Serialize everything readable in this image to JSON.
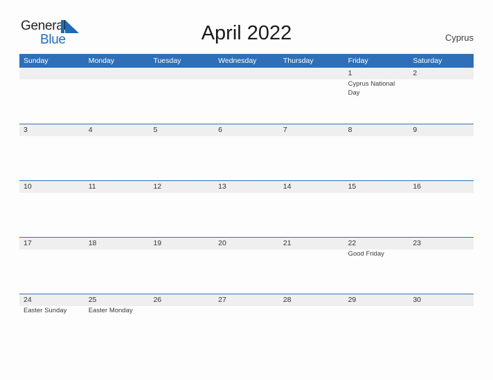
{
  "logo": {
    "word1": "General",
    "word2": "Blue",
    "triangle_icon": "blue-triangle-icon",
    "color_dark": "#231f20",
    "color_blue": "#1f6cb4"
  },
  "header": {
    "title": "April 2022",
    "country": "Cyprus"
  },
  "theme": {
    "header_blue": "#2e6fb7",
    "date_band_gray": "#efefef",
    "page_background": "#fdfdfd",
    "text_color": "#333333"
  },
  "calendar": {
    "day_headers": [
      "Sunday",
      "Monday",
      "Tuesday",
      "Wednesday",
      "Thursday",
      "Friday",
      "Saturday"
    ],
    "weeks": [
      [
        {
          "date": "",
          "events": []
        },
        {
          "date": "",
          "events": []
        },
        {
          "date": "",
          "events": []
        },
        {
          "date": "",
          "events": []
        },
        {
          "date": "",
          "events": []
        },
        {
          "date": "1",
          "events": [
            "Cyprus National Day"
          ]
        },
        {
          "date": "2",
          "events": []
        }
      ],
      [
        {
          "date": "3",
          "events": []
        },
        {
          "date": "4",
          "events": []
        },
        {
          "date": "5",
          "events": []
        },
        {
          "date": "6",
          "events": []
        },
        {
          "date": "7",
          "events": []
        },
        {
          "date": "8",
          "events": []
        },
        {
          "date": "9",
          "events": []
        }
      ],
      [
        {
          "date": "10",
          "events": []
        },
        {
          "date": "11",
          "events": []
        },
        {
          "date": "12",
          "events": []
        },
        {
          "date": "13",
          "events": []
        },
        {
          "date": "14",
          "events": []
        },
        {
          "date": "15",
          "events": []
        },
        {
          "date": "16",
          "events": []
        }
      ],
      [
        {
          "date": "17",
          "events": []
        },
        {
          "date": "18",
          "events": []
        },
        {
          "date": "19",
          "events": []
        },
        {
          "date": "20",
          "events": []
        },
        {
          "date": "21",
          "events": []
        },
        {
          "date": "22",
          "events": [
            "Good Friday"
          ]
        },
        {
          "date": "23",
          "events": []
        }
      ],
      [
        {
          "date": "24",
          "events": [
            "Easter Sunday"
          ]
        },
        {
          "date": "25",
          "events": [
            "Easter Monday"
          ]
        },
        {
          "date": "26",
          "events": []
        },
        {
          "date": "27",
          "events": []
        },
        {
          "date": "28",
          "events": []
        },
        {
          "date": "29",
          "events": []
        },
        {
          "date": "30",
          "events": []
        }
      ]
    ]
  }
}
